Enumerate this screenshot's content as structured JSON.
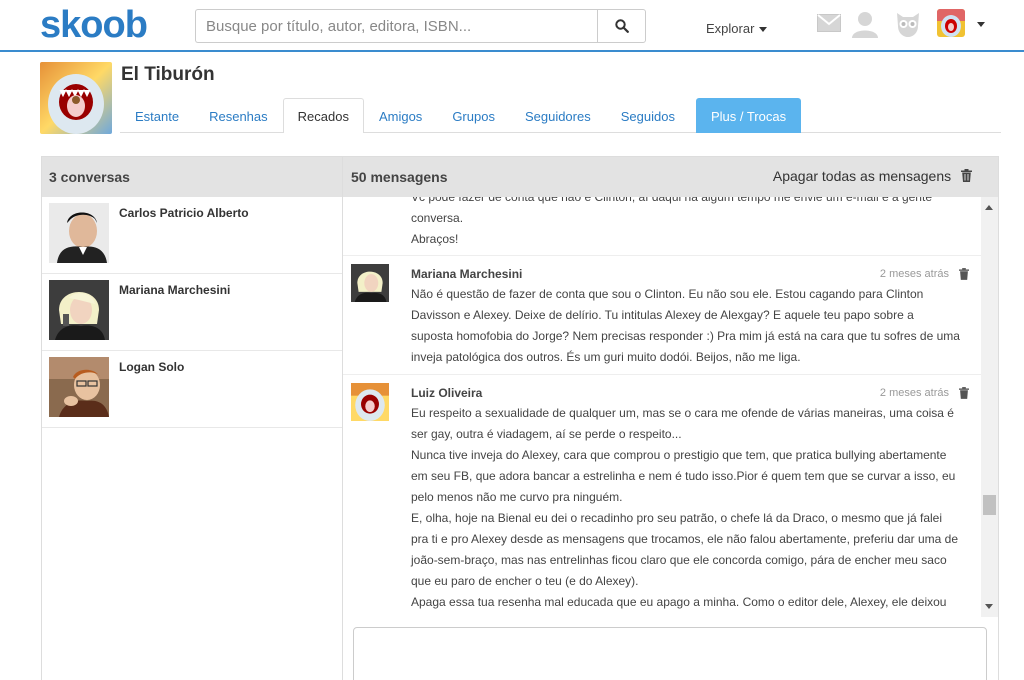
{
  "header": {
    "logo": "skoob",
    "search_placeholder": "Busque por título, autor, editora, ISBN...",
    "explore_label": "Explorar"
  },
  "profile": {
    "name": "El Tiburón"
  },
  "tabs": [
    {
      "label": "Estante"
    },
    {
      "label": "Resenhas"
    },
    {
      "label": "Recados"
    },
    {
      "label": "Amigos"
    },
    {
      "label": "Grupos"
    },
    {
      "label": "Seguidores"
    },
    {
      "label": "Seguidos"
    },
    {
      "label": "Plus / Trocas"
    }
  ],
  "conversations": {
    "header": "3 conversas",
    "items": [
      {
        "name": "Carlos Patricio Alberto"
      },
      {
        "name": "Mariana Marchesini"
      },
      {
        "name": "Logan Solo"
      }
    ]
  },
  "messages": {
    "header": "50 mensagens",
    "delete_all": "Apagar todas as mensagens",
    "partial": {
      "lines": [
        "Vc pode fazer de conta que não é Clinton, aí daqui há algum tempo me envie um e-mail e a gente",
        "conversa.",
        "Abraços!"
      ]
    },
    "items": [
      {
        "author": "Mariana Marchesini",
        "time": "2 meses atrás",
        "lines": [
          "Não é questão de fazer de conta que sou o Clinton. Eu não sou ele. Estou cagando para Clinton",
          "Davisson e Alexey. Deixe de delírio. Tu intitulas Alexey de Alexgay? E aquele teu papo sobre a",
          "suposta homofobia do Jorge? Nem precisas responder :) Pra mim já está na cara que tu sofres de uma",
          "inveja patológica dos outros. És um guri muito dodói. Beijos, não me liga."
        ]
      },
      {
        "author": "Luiz Oliveira",
        "time": "2 meses atrás",
        "lines": [
          "Eu respeito a sexualidade de qualquer um, mas se o cara me ofende de várias maneiras, uma coisa é",
          "ser gay, outra é viadagem, aí se perde o respeito...",
          "Nunca tive inveja do Alexey, cara que comprou o prestigio que tem, que pratica bullying abertamente",
          "em seu FB, que adora bancar a estrelinha e nem é tudo isso.Pior é quem tem que se curvar a isso, eu",
          "pelo menos não me curvo pra ninguém.",
          "E, olha, hoje na Bienal eu dei o recadinho pro seu patrão, o chefe lá da Draco, o mesmo que já falei",
          "pra ti e pro Alexey desde as mensagens que trocamos, ele não falou abertamente, preferiu dar uma de",
          "joão-sem-braço, mas nas entrelinhas ficou claro que ele concorda comigo, pára de encher meu saco",
          "que eu paro de encher o teu (e do Alexey).",
          "Apaga essa tua resenha mal educada que eu apago a minha. Como o editor dele, Alexey, ele deixou"
        ]
      }
    ]
  },
  "colors": {
    "brand": "#2b7cc4",
    "plus_tab": "#5bb4ee",
    "panel_header": "#e3e3e3"
  }
}
